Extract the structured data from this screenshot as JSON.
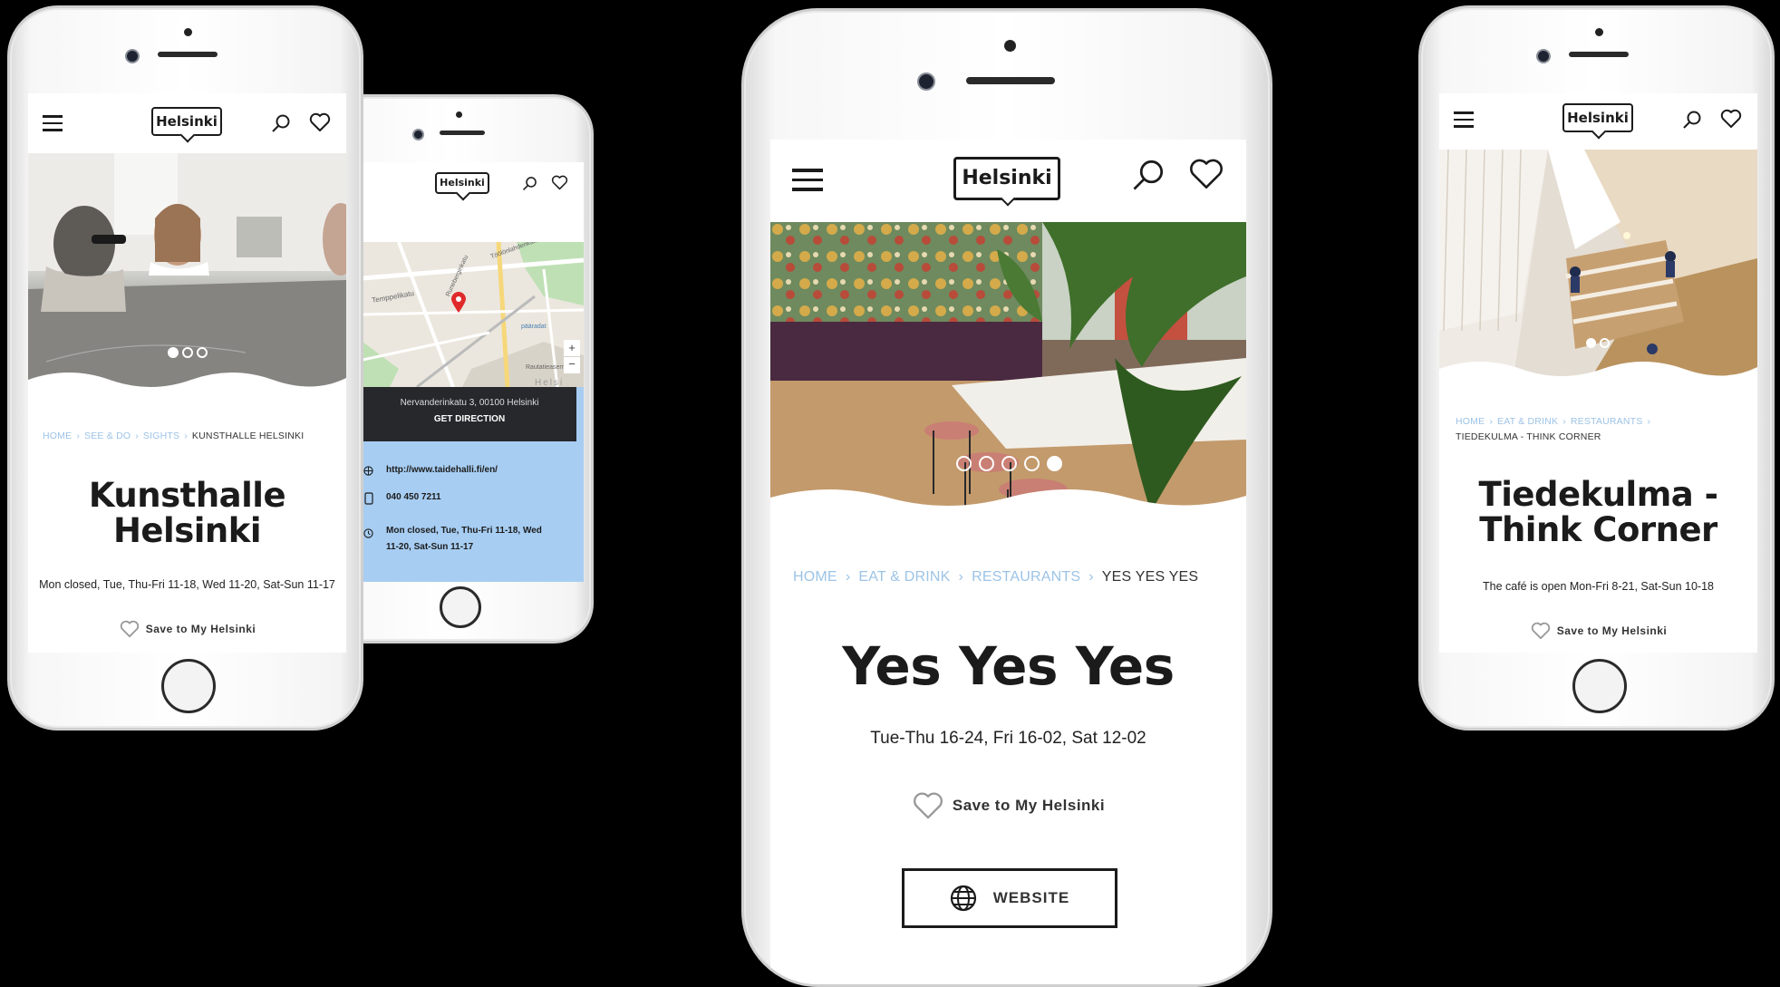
{
  "brand": {
    "logo_text": "Helsinki",
    "link_color": "#9cc3e6",
    "map_panel_color": "#a7cdf2",
    "dark": "#1b1b1b"
  },
  "phone1": {
    "breadcrumb": [
      "HOME",
      "SEE & DO",
      "SIGHTS"
    ],
    "breadcrumb_current": "KUNSTHALLE HELSINKI",
    "title": "Kunsthalle Helsinki",
    "hours": "Mon closed, Tue, Thu-Fri 11-18, Wed 11-20, Sat-Sun 11-17",
    "save_label": "Save to My Helsinki",
    "carousel_index": 1,
    "carousel_total": 3
  },
  "phone2": {
    "map": {
      "labels": [
        "Temppelikatu",
        "Runeberginkatu",
        "Töölönlahdenkatu",
        "pääradat",
        "Rautatieasema",
        "Helsi"
      ],
      "zoom_in": "+",
      "zoom_out": "−"
    },
    "address": "Nervanderinkatu 3, 00100 Helsinki",
    "direction_label": "GET DIRECTION",
    "website": "http://www.taidehalli.fi/en/",
    "phone": "040 450 7211",
    "hours": "Mon closed, Tue, Thu-Fri 11-18, Wed 11-20, Sat-Sun 11-17"
  },
  "phone3": {
    "breadcrumb": [
      "HOME",
      "EAT & DRINK",
      "RESTAURANTS"
    ],
    "breadcrumb_current": "YES YES YES",
    "title": "Yes Yes Yes",
    "hours": "Tue-Thu 16-24, Fri 16-02, Sat 12-02",
    "save_label": "Save to My Helsinki",
    "website_label": "WEBSITE",
    "carousel_index": 5,
    "carousel_total": 5
  },
  "phone4": {
    "breadcrumb": [
      "HOME",
      "EAT & DRINK",
      "RESTAURANTS"
    ],
    "breadcrumb_current": "TIEDEKULMA - THINK CORNER",
    "title": "Tiedekulma - Think Corner",
    "hours": "The café is open Mon-Fri 8-21, Sat-Sun 10-18",
    "save_label": "Save to My Helsinki",
    "carousel_index": 1,
    "carousel_total": 2
  }
}
